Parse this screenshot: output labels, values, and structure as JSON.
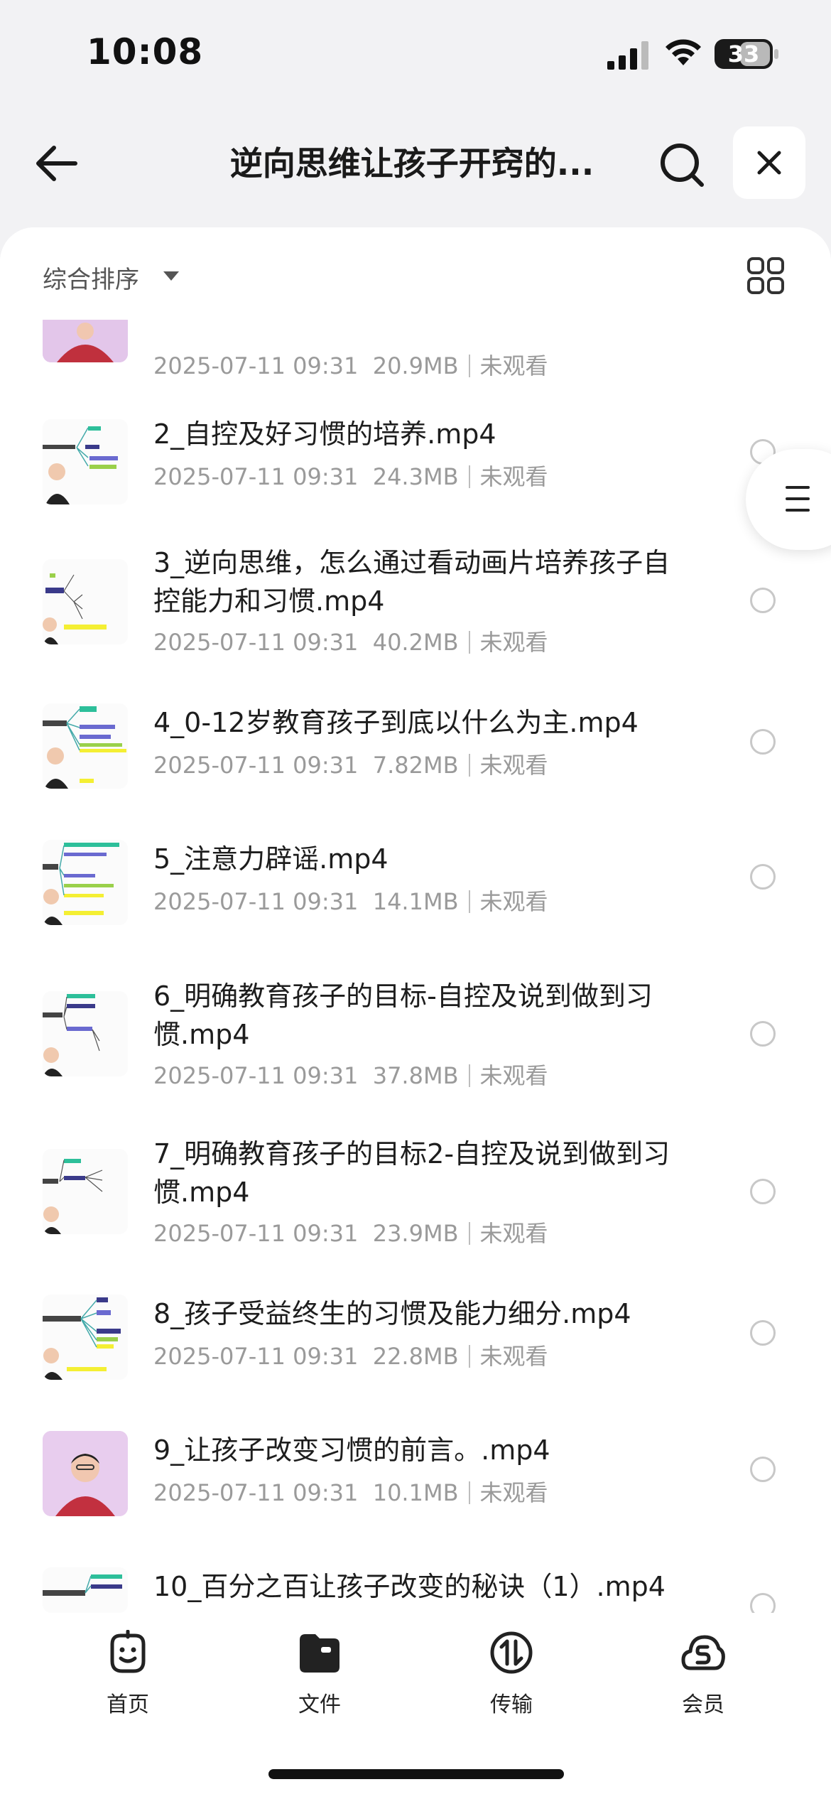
{
  "status": {
    "time": "10:08",
    "battery": "33"
  },
  "header": {
    "title": "逆向思维让孩子开窍的..."
  },
  "toolbar": {
    "sort_label": "综合排序"
  },
  "files": [
    {
      "name": "",
      "date": "2025-07-11 09:31",
      "size": "20.9MB",
      "status": "未观看"
    },
    {
      "name": "2_自控及好习惯的培养.mp4",
      "date": "2025-07-11 09:31",
      "size": "24.3MB",
      "status": "未观看"
    },
    {
      "name": "3_逆向思维，怎么通过看动画片培养孩子自控能力和习惯.mp4",
      "date": "2025-07-11 09:31",
      "size": "40.2MB",
      "status": "未观看"
    },
    {
      "name": "4_0-12岁教育孩子到底以什么为主.mp4",
      "date": "2025-07-11 09:31",
      "size": "7.82MB",
      "status": "未观看"
    },
    {
      "name": "5_注意力辟谣.mp4",
      "date": "2025-07-11 09:31",
      "size": "14.1MB",
      "status": "未观看"
    },
    {
      "name": "6_明确教育孩子的目标-自控及说到做到习惯.mp4",
      "date": "2025-07-11 09:31",
      "size": "37.8MB",
      "status": "未观看"
    },
    {
      "name": "7_明确教育孩子的目标2-自控及说到做到习惯.mp4",
      "date": "2025-07-11 09:31",
      "size": "23.9MB",
      "status": "未观看"
    },
    {
      "name": "8_孩子受益终生的习惯及能力细分.mp4",
      "date": "2025-07-11 09:31",
      "size": "22.8MB",
      "status": "未观看"
    },
    {
      "name": "9_让孩子改变习惯的前言。.mp4",
      "date": "2025-07-11 09:31",
      "size": "10.1MB",
      "status": "未观看"
    },
    {
      "name": "10_百分之百让孩子改变的秘诀（1）.mp4",
      "date": "",
      "size": "",
      "status": ""
    }
  ],
  "tabs": [
    {
      "label": "首页",
      "icon": "home-face-icon"
    },
    {
      "label": "文件",
      "icon": "folder-icon"
    },
    {
      "label": "传输",
      "icon": "transfer-icon"
    },
    {
      "label": "会员",
      "icon": "vip-cloud-icon"
    }
  ],
  "colors": {
    "accent": "#1a1a1a",
    "meta": "#9a9a9a",
    "background": "#f2f2f4"
  }
}
